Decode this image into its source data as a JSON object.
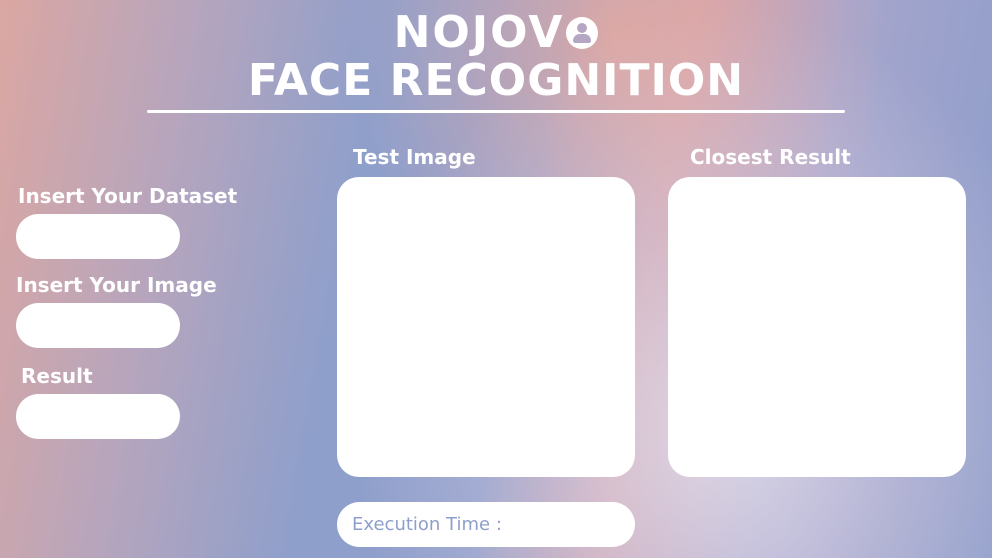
{
  "header": {
    "brand_text": "NOJOV",
    "brand_icon": "user-icon",
    "subtitle": "FACE RECOGNITION"
  },
  "sidebar": {
    "dataset_label": "Insert Your Dataset",
    "dataset_value": "",
    "image_label": "Insert Your Image",
    "image_value": "",
    "result_label": "Result",
    "result_value": ""
  },
  "panels": {
    "test_image_title": "Test Image",
    "closest_result_title": "Closest Result"
  },
  "footer": {
    "execution_time_label": "Execution Time :"
  },
  "colors": {
    "text": "#ffffff",
    "panel": "#ffffff",
    "accent_text": "#8e9fcb"
  }
}
